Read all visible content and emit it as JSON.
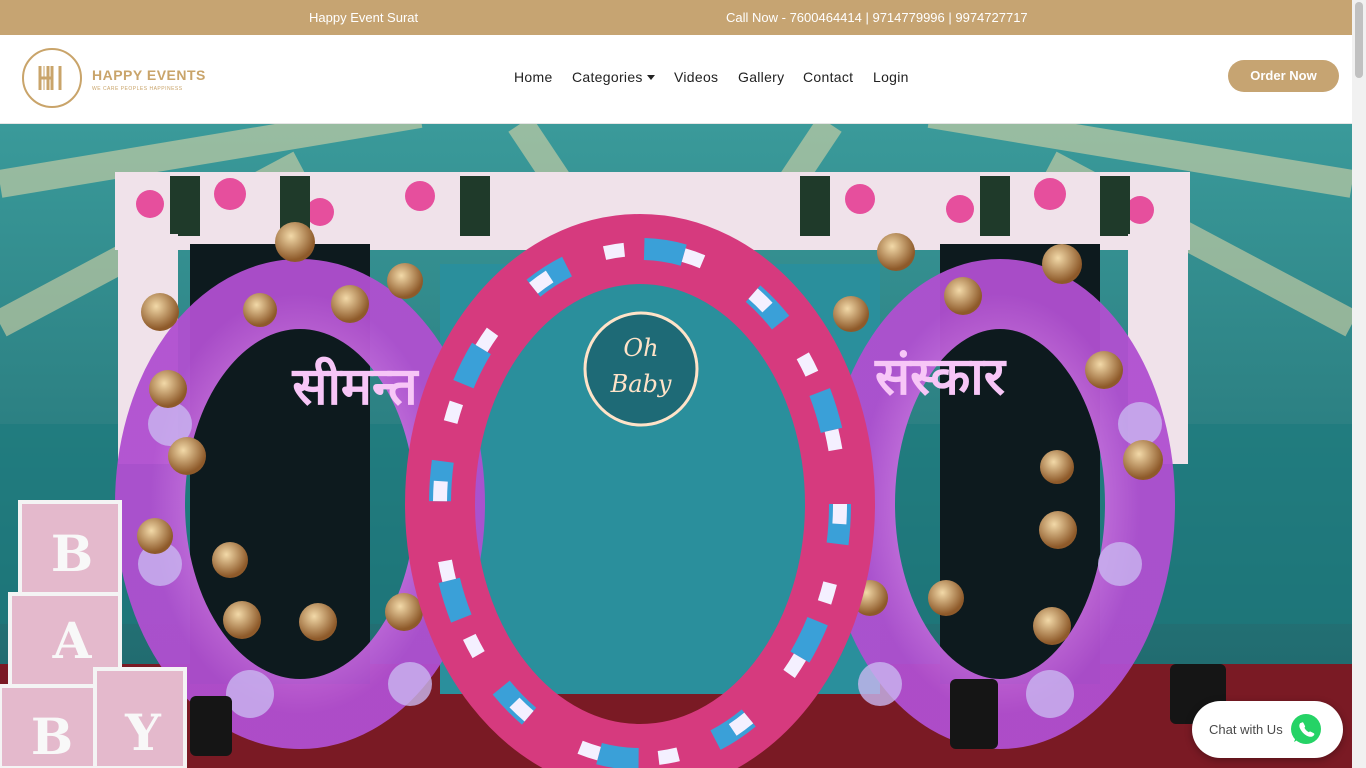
{
  "topbar": {
    "company": "Happy Event Surat",
    "call": "Call Now - 7600464414 | 9714779996 | 9974727717"
  },
  "logo": {
    "name": "HAPPY EVENTS",
    "tagline": "WE CARE PEOPLES HAPPINESS"
  },
  "nav": {
    "home": "Home",
    "categories": "Categories",
    "videos": "Videos",
    "gallery": "Gallery",
    "contact": "Contact",
    "login": "Login"
  },
  "header": {
    "order_label": "Order Now"
  },
  "hero": {
    "banner_left_text": "सीमन्त",
    "banner_right_text": "संस्कार",
    "neon_line1": "Oh",
    "neon_line2": "Baby",
    "blocks": [
      "B",
      "A",
      "B",
      "Y"
    ]
  },
  "chat": {
    "label": "Chat with Us",
    "icon": "whatsapp-icon"
  },
  "colors": {
    "accent": "#c6a472",
    "logo_gold": "#c9a46a",
    "whatsapp_green": "#25d366"
  }
}
